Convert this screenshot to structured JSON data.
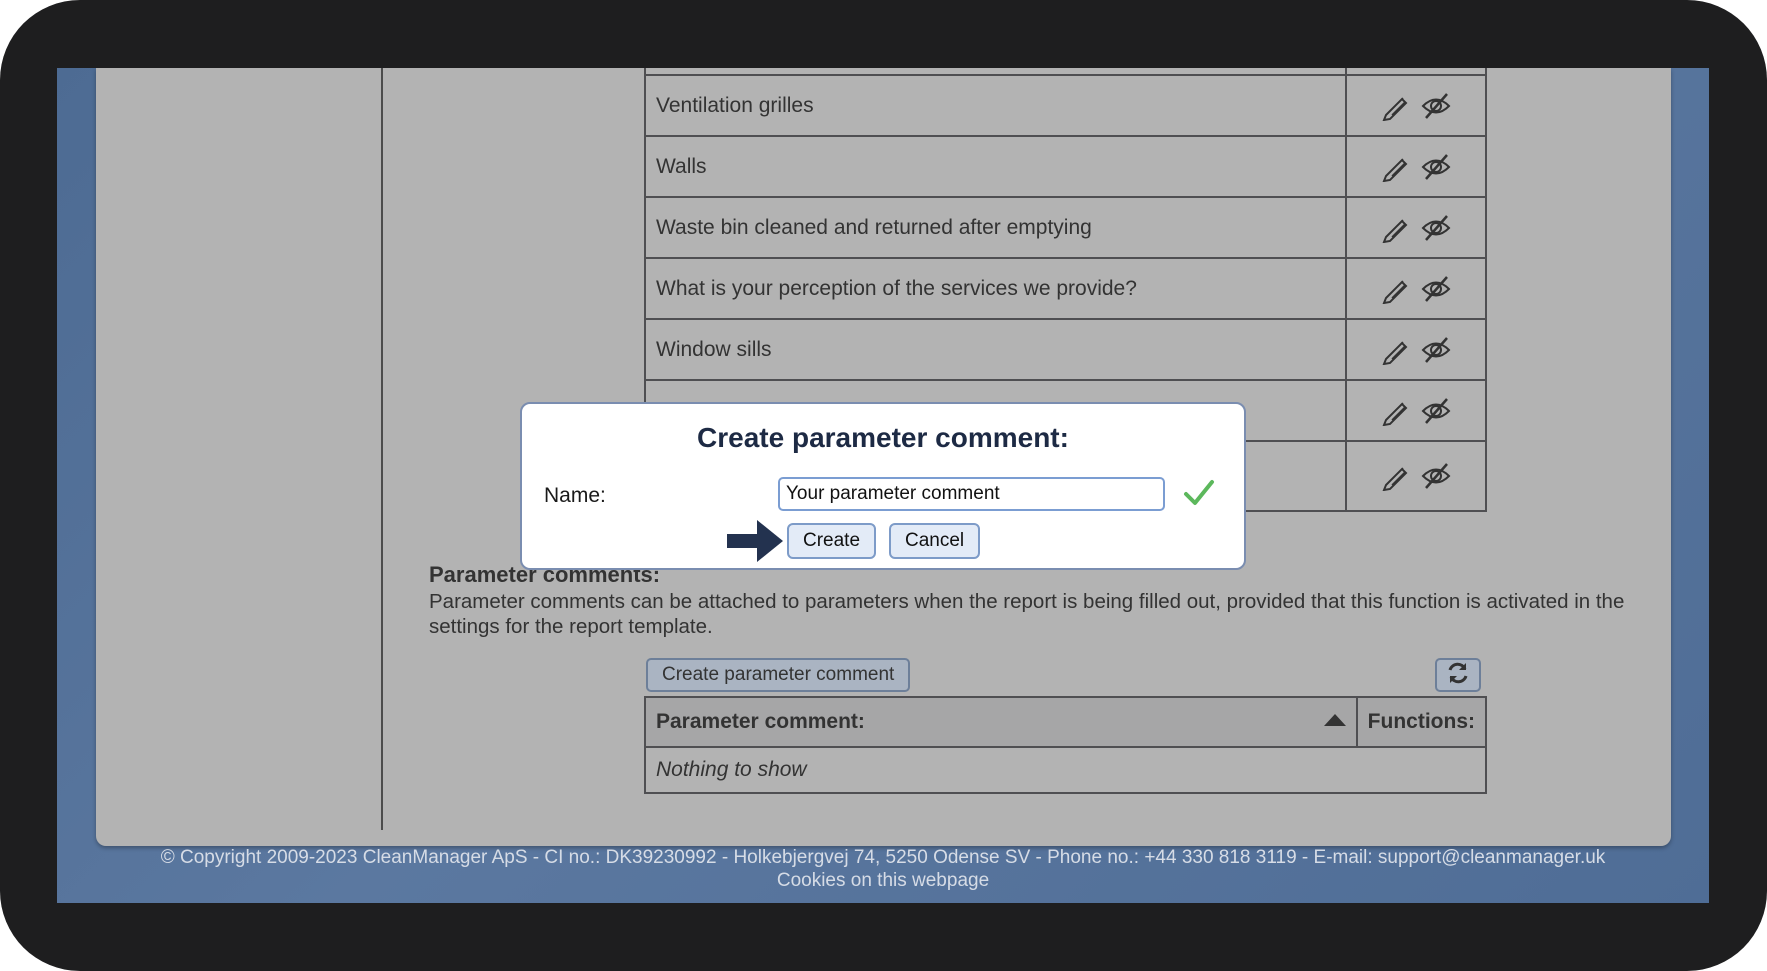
{
  "parameters": [
    {
      "name": "Ventilation grilles"
    },
    {
      "name": "Walls"
    },
    {
      "name": "Waste bin cleaned and returned after emptying"
    },
    {
      "name": "What is your perception of the services we provide?"
    },
    {
      "name": "Window sills"
    },
    {
      "name": ""
    },
    {
      "name": ""
    }
  ],
  "icons": {
    "edit": "pencil-icon",
    "hide": "eye-slash-icon",
    "refresh": "refresh-icon",
    "check": "checkmark-icon",
    "arrow": "arrow-right-icon"
  },
  "comments_section": {
    "title": "Parameter comments:",
    "description": "Parameter comments can be attached to parameters when the report is being filled out, provided that this function is activated in the settings for the report template.",
    "create_button": "Create parameter comment",
    "table": {
      "col_comment": "Parameter comment:",
      "col_functions": "Functions:",
      "empty_text": "Nothing to show"
    }
  },
  "modal": {
    "title": "Create parameter comment:",
    "name_label": "Name:",
    "name_value": "Your parameter comment",
    "create_label": "Create",
    "cancel_label": "Cancel"
  },
  "footer": {
    "copyright": "© Copyright 2009-2023 CleanManager ApS - CI no.: DK39230992 - Holkebjergvej 74, 5250 Odense SV - Phone no.: +44 330 818 3119 - E-mail: support@cleanmanager.uk",
    "cookies_link": "Cookies on this webpage"
  },
  "colors": {
    "accent": "#1d2a44",
    "valid": "#5cb85c",
    "overlay": "#b3b3b3"
  }
}
